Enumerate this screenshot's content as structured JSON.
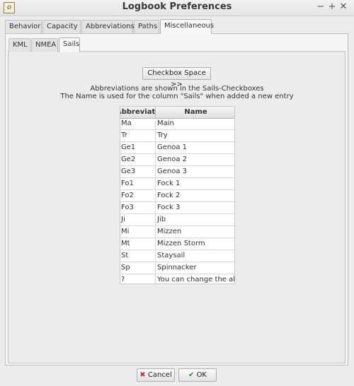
{
  "window": {
    "title": "Logbook Preferences",
    "minimize": "−",
    "maximize": "+",
    "close": "✕",
    "app_icon": "logbook-icon"
  },
  "outer_tabs": [
    {
      "label": "Behavior",
      "active": false
    },
    {
      "label": "Capacity",
      "active": false
    },
    {
      "label": "Abbreviations",
      "active": false
    },
    {
      "label": "Paths",
      "active": false
    },
    {
      "label": "Miscellaneous",
      "active": true
    }
  ],
  "inner_tabs": [
    {
      "label": "KML",
      "active": false
    },
    {
      "label": "NMEA",
      "active": false
    },
    {
      "label": "Sails",
      "active": true
    }
  ],
  "checkbox_space_button": "Checkbox Space  >>",
  "info_line1": "Abbreviations are shown in the Sails-Checkboxes",
  "info_line2": "The Name is used for the column \"Sails\" when added a new entry",
  "table": {
    "headers": [
      "Abbreviation",
      "Name"
    ],
    "rows": [
      [
        "Ma",
        "Main"
      ],
      [
        "Tr",
        "Try"
      ],
      [
        "Ge1",
        "Genoa 1"
      ],
      [
        "Ge2",
        "Genoa 2"
      ],
      [
        "Ge3",
        "Genoa 3"
      ],
      [
        "Fo1",
        "Fock 1"
      ],
      [
        "Fo2",
        "Fock 2"
      ],
      [
        "Fo3",
        "Fock 3"
      ],
      [
        "Ji",
        "Jib"
      ],
      [
        "Mi",
        "Mizzen"
      ],
      [
        "Mt",
        "Mizzen Storm"
      ],
      [
        "St",
        "Staysail"
      ],
      [
        "Sp",
        "Spinnacker"
      ],
      [
        "?",
        "You can change the abre"
      ]
    ]
  },
  "cancel_label": "Cancel",
  "ok_label": "OK",
  "colors": {
    "cancel_icon": "#c0392b",
    "ok_icon": "#2e7d32"
  }
}
